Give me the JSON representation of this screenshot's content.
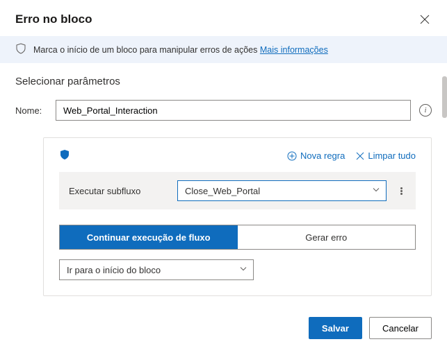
{
  "header": {
    "title": "Erro no bloco"
  },
  "info": {
    "text": "Marca o início de um bloco para manipular erros de ações ",
    "link": "Mais informações"
  },
  "section": {
    "title": "Selecionar parâmetros"
  },
  "name_field": {
    "label": "Nome:",
    "value": "Web_Portal_Interaction"
  },
  "rules": {
    "new_rule": "Nova regra",
    "clear_all": "Limpar tudo",
    "row": {
      "label": "Executar subfluxo",
      "value": "Close_Web_Portal"
    },
    "toggle": {
      "continue": "Continuar execução de fluxo",
      "throw": "Gerar erro"
    },
    "goto": {
      "value": "Ir para o início do bloco"
    }
  },
  "footer": {
    "save": "Salvar",
    "cancel": "Cancelar"
  }
}
